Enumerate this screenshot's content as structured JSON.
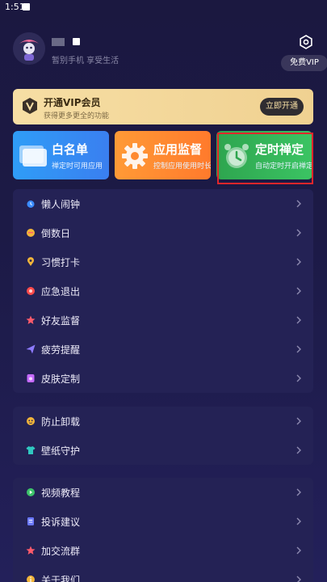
{
  "status_bar": {
    "time": "1:51"
  },
  "profile": {
    "subtitle": "暂别手机 享受生活",
    "free_vip_label": "免费VIP"
  },
  "vip_banner": {
    "title": "开通VIP会员",
    "subtitle": "获得更多更全的功能",
    "button_label": "立即开通"
  },
  "feature_cards": [
    {
      "title": "白名单",
      "subtitle": "禅定时可用应用",
      "color": "#2f9df7"
    },
    {
      "title": "应用监督",
      "subtitle": "控制应用使用时长",
      "color": "#ff8a30"
    },
    {
      "title": "定时禅定",
      "subtitle": "自动定时开启禅定",
      "color": "#33b457"
    }
  ],
  "menu_group_1": [
    {
      "label": "懒人闹钟",
      "icon": "alarm-icon",
      "icon_color": "#3b8cff"
    },
    {
      "label": "倒数日",
      "icon": "calendar-icon",
      "icon_color": "#f2b53a"
    },
    {
      "label": "习惯打卡",
      "icon": "location-pin-icon",
      "icon_color": "#f2b53a"
    },
    {
      "label": "应急退出",
      "icon": "emergency-icon",
      "icon_color": "#ff4b4b"
    },
    {
      "label": "好友监督",
      "icon": "star-icon",
      "icon_color": "#ff5b6b"
    },
    {
      "label": "疲劳提醒",
      "icon": "paper-plane-icon",
      "icon_color": "#8e7bff"
    },
    {
      "label": "皮肤定制",
      "icon": "skin-icon",
      "icon_color": "#c76bff"
    }
  ],
  "menu_group_2": [
    {
      "label": "防止卸载",
      "icon": "shield-face-icon",
      "icon_color": "#f2b53a"
    },
    {
      "label": "壁纸守护",
      "icon": "tshirt-icon",
      "icon_color": "#30c8c0"
    }
  ],
  "menu_group_3": [
    {
      "label": "视频教程",
      "icon": "play-icon",
      "icon_color": "#3cc46a"
    },
    {
      "label": "投诉建议",
      "icon": "document-icon",
      "icon_color": "#6a78ff"
    },
    {
      "label": "加交流群",
      "icon": "star-icon",
      "icon_color": "#ff5b6b"
    },
    {
      "label": "关于我们",
      "icon": "info-icon",
      "icon_color": "#f2b53a"
    }
  ]
}
